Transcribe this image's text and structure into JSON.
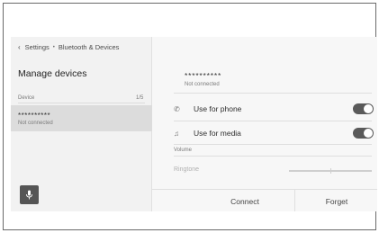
{
  "breadcrumb": {
    "back_icon": "chevron-left-icon",
    "items": [
      "Settings",
      "Bluetooth & Devices"
    ]
  },
  "left": {
    "title": "Manage devices",
    "section_label": "Device",
    "count": "1/5",
    "device": {
      "name": "**********",
      "status": "Not connected"
    },
    "mic_icon": "microphone-icon"
  },
  "right": {
    "device_name": "**********",
    "device_status": "Not connected",
    "rows": [
      {
        "icon": "phone-icon",
        "label": "Use for phone",
        "enabled": true
      },
      {
        "icon": "music-note-icon",
        "label": "Use for media",
        "enabled": true
      }
    ],
    "volume_label": "Volume",
    "ringtone_label": "Ringtone",
    "connect_label": "Connect",
    "forget_label": "Forget"
  },
  "colors": {
    "toggle_on": "#5a5a5a",
    "selected_row": "#dcdcdc",
    "mic_button": "#555555"
  }
}
